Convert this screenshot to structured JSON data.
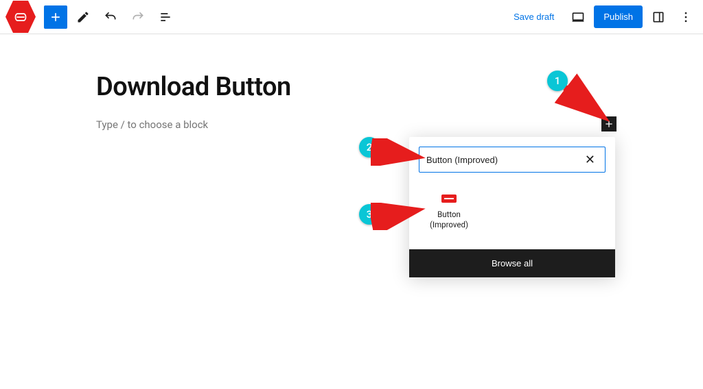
{
  "toolbar": {
    "save_draft_label": "Save draft",
    "publish_label": "Publish"
  },
  "editor": {
    "title": "Download Button",
    "placeholder": "Type / to choose a block"
  },
  "inserter": {
    "search_value": "Button (Improved)",
    "block_result_label": "Button (Improved)",
    "browse_all_label": "Browse all"
  },
  "callouts": {
    "one": "1",
    "two": "2",
    "three": "3"
  }
}
